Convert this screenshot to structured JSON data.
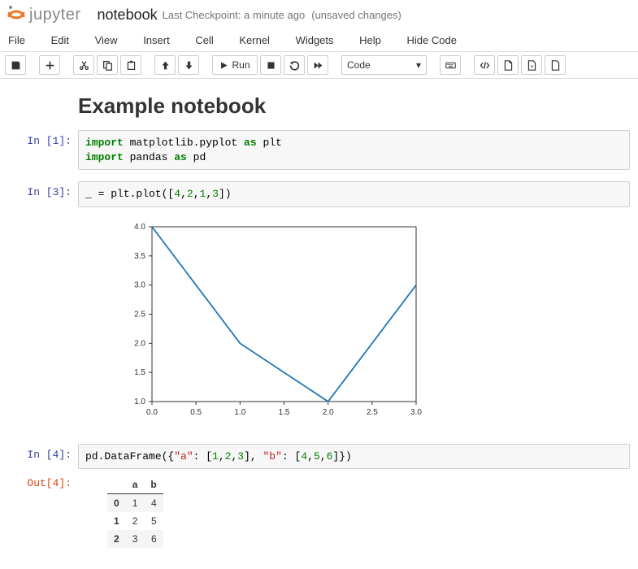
{
  "header": {
    "brand": "jupyter",
    "title": "notebook",
    "checkpoint": "Last Checkpoint: a minute ago",
    "unsaved": "(unsaved changes)"
  },
  "menu": [
    "File",
    "Edit",
    "View",
    "Insert",
    "Cell",
    "Kernel",
    "Widgets",
    "Help",
    "Hide Code"
  ],
  "toolbar": {
    "run_label": "Run",
    "celltype": "Code"
  },
  "markdown": {
    "heading": "Example notebook"
  },
  "cells": {
    "c1": {
      "prompt": "In [1]:",
      "tokens": [
        {
          "t": "import",
          "c": "kw"
        },
        {
          "t": " matplotlib.pyplot ",
          "c": "nm"
        },
        {
          "t": "as",
          "c": "kw"
        },
        {
          "t": " plt",
          "c": "nm"
        },
        {
          "t": "\n",
          "c": "nm"
        },
        {
          "t": "import",
          "c": "kw"
        },
        {
          "t": " pandas ",
          "c": "nm"
        },
        {
          "t": "as",
          "c": "kw"
        },
        {
          "t": " pd",
          "c": "nm"
        }
      ]
    },
    "c2": {
      "prompt": "In [3]:",
      "tokens": [
        {
          "t": "_ ",
          "c": "nm"
        },
        {
          "t": "=",
          "c": "nm"
        },
        {
          "t": " plt.plot([",
          "c": "nm"
        },
        {
          "t": "4",
          "c": "num"
        },
        {
          "t": ",",
          "c": "nm"
        },
        {
          "t": "2",
          "c": "num"
        },
        {
          "t": ",",
          "c": "nm"
        },
        {
          "t": "1",
          "c": "num"
        },
        {
          "t": ",",
          "c": "nm"
        },
        {
          "t": "3",
          "c": "num"
        },
        {
          "t": "])",
          "c": "nm"
        }
      ]
    },
    "c3": {
      "prompt": "In [4]:",
      "out_prompt": "Out[4]:",
      "tokens": [
        {
          "t": "pd.DataFrame({",
          "c": "nm"
        },
        {
          "t": "\"a\"",
          "c": "str"
        },
        {
          "t": ": [",
          "c": "nm"
        },
        {
          "t": "1",
          "c": "num"
        },
        {
          "t": ",",
          "c": "nm"
        },
        {
          "t": "2",
          "c": "num"
        },
        {
          "t": ",",
          "c": "nm"
        },
        {
          "t": "3",
          "c": "num"
        },
        {
          "t": "], ",
          "c": "nm"
        },
        {
          "t": "\"b\"",
          "c": "str"
        },
        {
          "t": ": [",
          "c": "nm"
        },
        {
          "t": "4",
          "c": "num"
        },
        {
          "t": ",",
          "c": "nm"
        },
        {
          "t": "5",
          "c": "num"
        },
        {
          "t": ",",
          "c": "nm"
        },
        {
          "t": "6",
          "c": "num"
        },
        {
          "t": "]})",
          "c": "nm"
        }
      ]
    }
  },
  "chart_data": {
    "type": "line",
    "x": [
      0,
      1,
      2,
      3
    ],
    "y": [
      4,
      2,
      1,
      3
    ],
    "xlim": [
      0,
      3
    ],
    "ylim": [
      1,
      4
    ],
    "xticks": [
      0.0,
      0.5,
      1.0,
      1.5,
      2.0,
      2.5,
      3.0
    ],
    "yticks": [
      1.0,
      1.5,
      2.0,
      2.5,
      3.0,
      3.5,
      4.0
    ],
    "line_color": "#1f77b4"
  },
  "dataframe": {
    "columns": [
      "a",
      "b"
    ],
    "index": [
      "0",
      "1",
      "2"
    ],
    "rows": [
      [
        1,
        4
      ],
      [
        2,
        5
      ],
      [
        3,
        6
      ]
    ]
  }
}
